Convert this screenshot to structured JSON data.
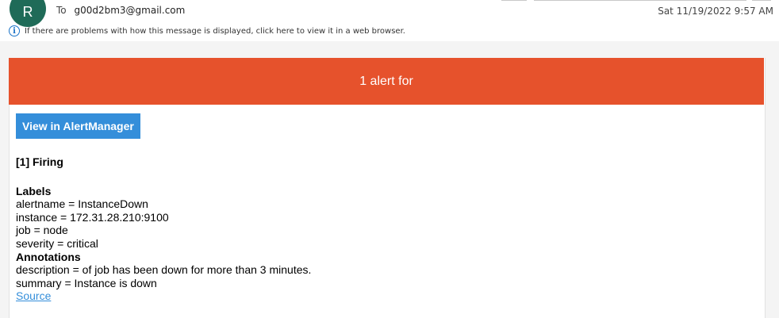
{
  "header": {
    "avatar_initial": "R",
    "to_label": "To",
    "to_address": "g00d2bm3@gmail.com",
    "date": "Sat 11/19/2022 9:57 AM",
    "info_text": "If there are problems with how this message is displayed, click here to view it in a web browser."
  },
  "email": {
    "banner": "1 alert for",
    "view_button": "View in AlertManager",
    "firing": "[1] Firing",
    "labels_heading": "Labels",
    "labels": [
      "alertname = InstanceDown",
      "instance = 172.31.28.210:9100",
      "job = node",
      "severity = critical"
    ],
    "annotations_heading": "Annotations",
    "annotations": [
      "description = of job has been down for more than 3 minutes.",
      "summary = Instance is down"
    ],
    "source_link": "Source"
  },
  "colors": {
    "banner": "#e6522c",
    "button": "#348eda",
    "avatar": "#1f6b58"
  }
}
